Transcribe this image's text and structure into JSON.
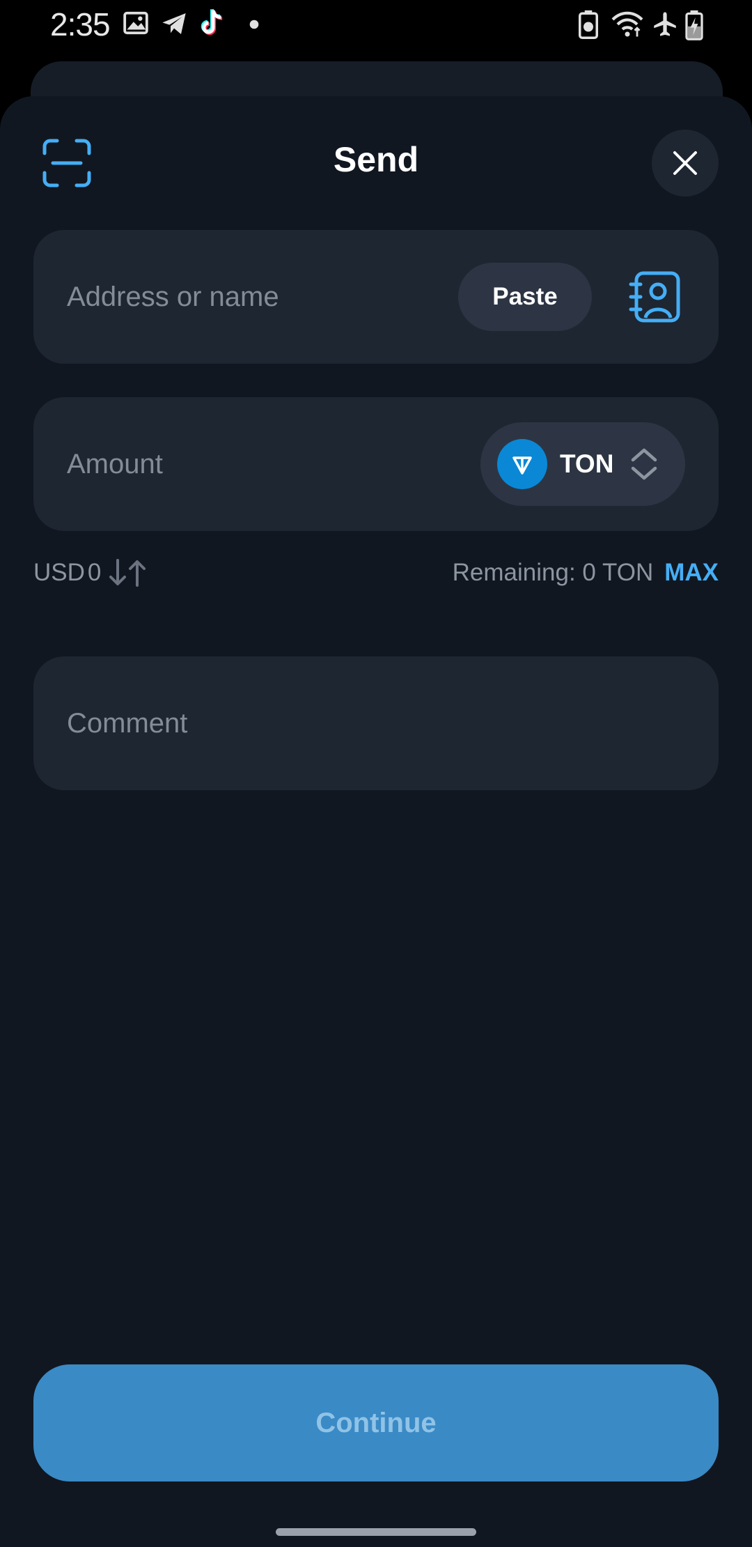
{
  "status_bar": {
    "time": "2:35",
    "left_icons": [
      "gallery-icon",
      "telegram-icon",
      "tiktok-icon",
      "dot-icon"
    ],
    "right_icons": [
      "battery-saver-icon",
      "wifi-icon",
      "airplane-mode-icon",
      "battery-charging-icon"
    ]
  },
  "header": {
    "title": "Send",
    "scan_icon": "scan-qr-icon",
    "close_icon": "close-icon"
  },
  "address_field": {
    "placeholder": "Address or name",
    "paste_label": "Paste",
    "contacts_icon": "contacts-book-icon"
  },
  "amount_field": {
    "placeholder": "Amount",
    "token": "TON",
    "token_icon": "ton-logo-icon",
    "chevron_icon": "chevron-up-down-icon"
  },
  "conversion": {
    "currency": "USD",
    "value": "0",
    "swap_icon": "swap-arrows-icon"
  },
  "balance": {
    "remaining_label": "Remaining: 0 TON",
    "max_label": "MAX"
  },
  "comment_field": {
    "placeholder": "Comment"
  },
  "footer": {
    "continue_label": "Continue"
  },
  "colors": {
    "background": "#111720",
    "field": "#1e2632",
    "accent": "#45aef5",
    "continue_bg": "#3a8ac6",
    "ton_blue": "#0a88d6"
  }
}
